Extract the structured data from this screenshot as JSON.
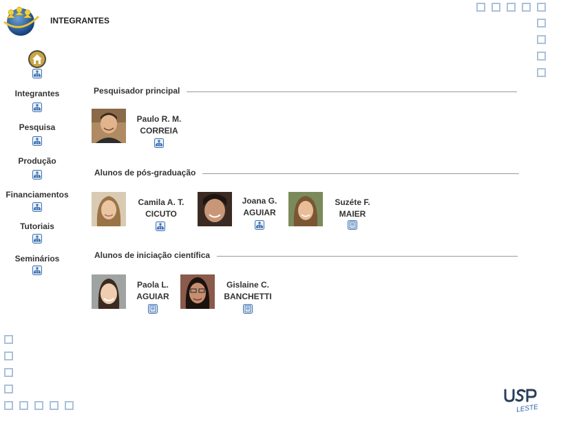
{
  "header": {
    "title": "INTEGRANTES"
  },
  "nav": {
    "items": [
      {
        "label": "Integrantes"
      },
      {
        "label": "Pesquisa"
      },
      {
        "label": "Produção"
      },
      {
        "label": "Financiamentos"
      },
      {
        "label": "Tutoriais"
      },
      {
        "label": "Seminários"
      }
    ]
  },
  "sections": {
    "principal": {
      "heading": "Pesquisador principal",
      "members": [
        {
          "name_line1": "Paulo R. M.",
          "name_line2": "CORREIA",
          "link_icon": "lattes-icon"
        }
      ]
    },
    "pos": {
      "heading": "Alunos de pós-graduação",
      "members": [
        {
          "name_line1": "Camila A. T.",
          "name_line2": "CICUTO",
          "link_icon": "lattes-icon"
        },
        {
          "name_line1": "Joana G.",
          "name_line2": "AGUIAR",
          "link_icon": "lattes-icon"
        },
        {
          "name_line1": "Suzéte F.",
          "name_line2": "MAIER",
          "link_icon": "document-icon"
        }
      ]
    },
    "ic": {
      "heading": "Alunos de iniciação científica",
      "members": [
        {
          "name_line1": "Paola L.",
          "name_line2": "AGUIAR",
          "link_icon": "document-icon"
        },
        {
          "name_line1": "Gislaine C.",
          "name_line2": "BANCHETTI",
          "link_icon": "document-icon"
        }
      ]
    }
  },
  "colors": {
    "square_border": "#a9c1d9",
    "icon_blue": "#3b6fb0",
    "rule": "#999999"
  }
}
